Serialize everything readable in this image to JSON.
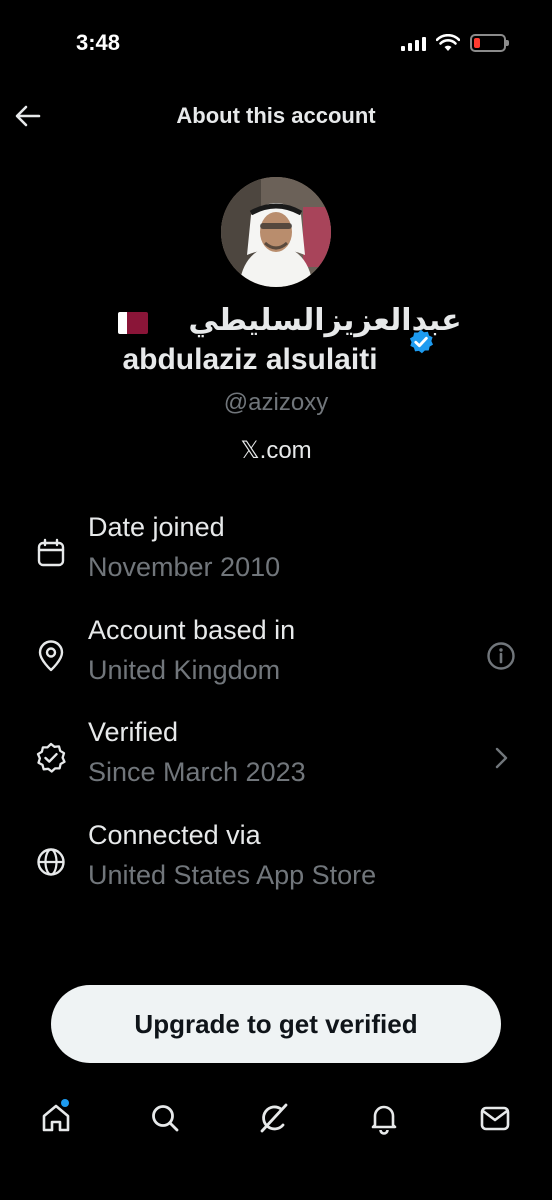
{
  "status_bar": {
    "time": "3:48"
  },
  "header": {
    "title": "About this account"
  },
  "profile": {
    "name_arabic": "عبدالعزيزالسليطي",
    "name_latin": "abdulaziz alsulaiti",
    "handle": "@azizoxy",
    "connected_site": "𝕏.com"
  },
  "details": [
    {
      "label": "Date joined",
      "value": "November 2010",
      "icon": "calendar-icon"
    },
    {
      "label": "Account based in",
      "value": "United Kingdom",
      "icon": "location-pin-icon",
      "trail": "info-icon"
    },
    {
      "label": "Verified",
      "value": "Since March 2023",
      "icon": "verified-seal-icon",
      "trail": "chevron-right-icon"
    },
    {
      "label": "Connected via",
      "value": "United States App Store",
      "icon": "globe-icon"
    }
  ],
  "upgrade_button": {
    "label": "Upgrade to get verified"
  },
  "tabs": [
    "home-icon",
    "search-icon",
    "grok-icon",
    "notifications-icon",
    "messages-icon"
  ],
  "colors": {
    "accent": "#1d9bf0",
    "background": "#000000",
    "secondary_text": "#71767b",
    "battery_low": "#ff3b30",
    "flag_maroon": "#8a1538"
  }
}
